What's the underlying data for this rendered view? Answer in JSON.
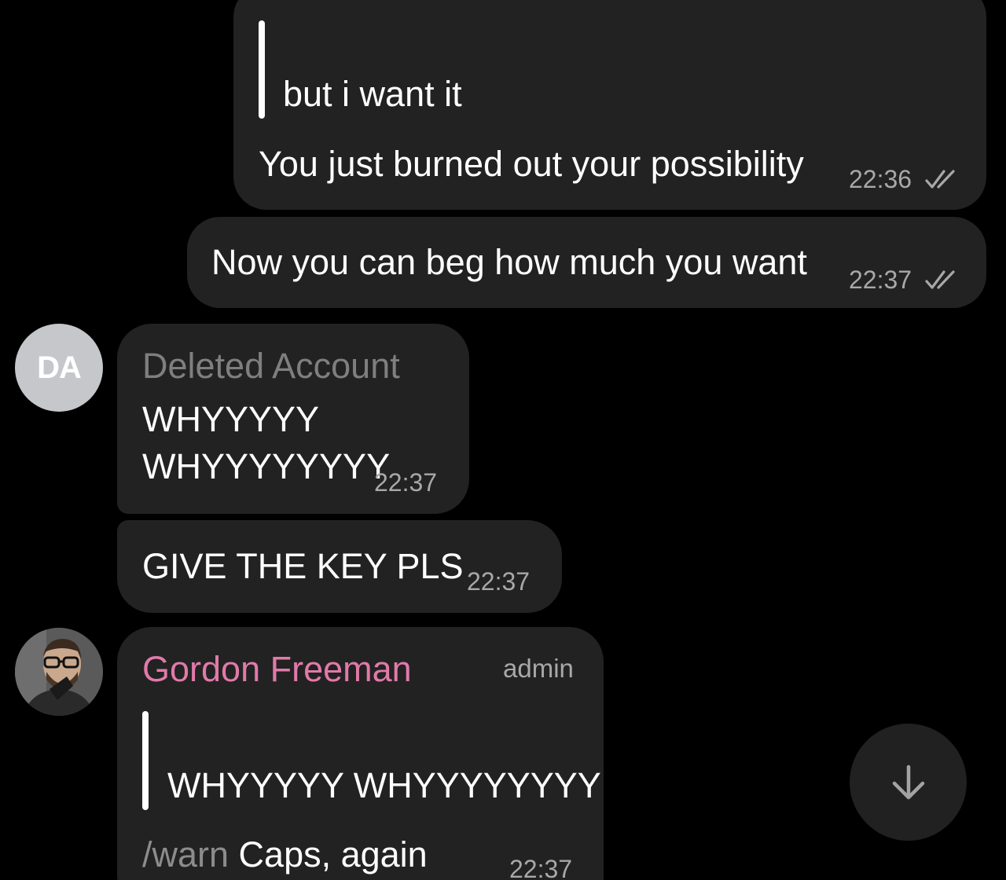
{
  "messages": [
    {
      "direction": "outgoing",
      "quote": "but i want it",
      "text": "You just burned out your possibility",
      "time": "22:36",
      "status": "double-check-read"
    },
    {
      "direction": "outgoing",
      "text": "Now you can beg how much you want",
      "time": "22:37",
      "status": "double-check-read"
    },
    {
      "direction": "incoming",
      "sender": "Deleted Account",
      "avatar_initials": "DA",
      "line1": "WHYYYYY",
      "line2": "WHYYYYYYYY",
      "time": "22:37"
    },
    {
      "direction": "incoming",
      "text": "GIVE THE KEY PLS",
      "time": "22:37"
    },
    {
      "direction": "incoming",
      "sender": "Gordon Freeman",
      "role": "admin",
      "quote": "WHYYYYY WHYYYYYYYY",
      "command": "/warn",
      "text": " Caps, again",
      "time": "22:37"
    }
  ],
  "colors": {
    "background": "#000000",
    "bubble": "#222222",
    "deleted_account_name": "#7f7f7f",
    "gordon_name": "#e07aa9",
    "time": "#a8a8a8",
    "command": "#8c8c8c",
    "avatar_da_bg": "#c6c7cb"
  },
  "icons": {
    "read_status": "double-check-icon",
    "scroll_down": "arrow-down-icon"
  }
}
